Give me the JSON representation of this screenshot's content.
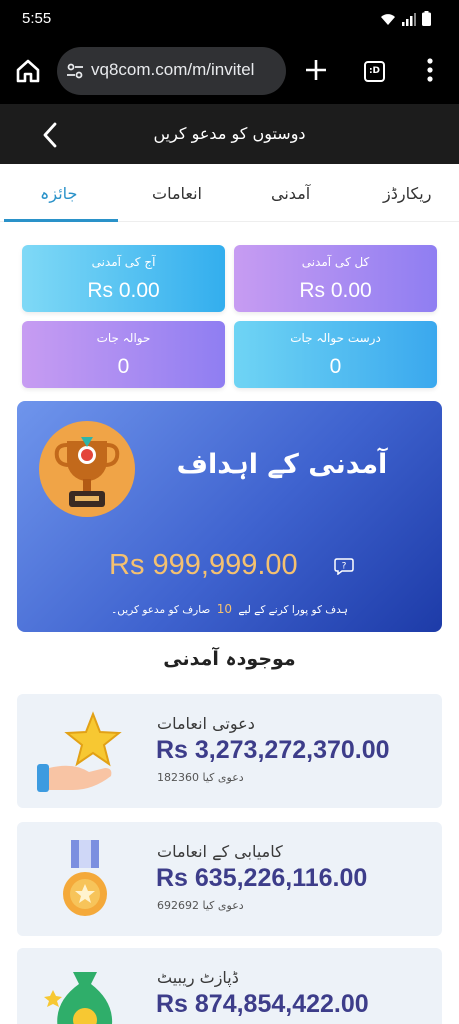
{
  "status": {
    "time": "5:55"
  },
  "browser": {
    "url": "vq8com.com/m/invitel",
    "tabs_label": ":D"
  },
  "header": {
    "title": "دوستوں کو مدعو کریں"
  },
  "tabs": [
    {
      "label": "ریکارڈز"
    },
    {
      "label": "آمدنی"
    },
    {
      "label": "انعامات"
    },
    {
      "label": "جائزہ",
      "active": true
    }
  ],
  "stats": {
    "today_earnings": {
      "label": "آج کی آمدنی",
      "value": "Rs 0.00"
    },
    "total_earnings": {
      "label": "کل کی آمدنی",
      "value": "Rs 0.00"
    },
    "referrals": {
      "label": "حوالہ جات",
      "value": "0"
    },
    "valid_referrals": {
      "label": "درست حوالہ جات",
      "value": "0"
    }
  },
  "goal": {
    "title": "آمدنی کے اہداف",
    "amount": "Rs 999,999.00",
    "note_before": "ہدف کو پورا کرنے کے لیے",
    "note_count": "10",
    "note_after": "صارف کو مدعو کریں۔"
  },
  "section_title": "موجودہ آمدنی",
  "earnings": [
    {
      "name": "دعوتی انعامات",
      "amount": "Rs 3,273,272,370.00",
      "count": "182360 دعوی کیا"
    },
    {
      "name": "کامیابی کے انعامات",
      "amount": "Rs 635,226,116.00",
      "count": "692692 دعوی کیا"
    },
    {
      "name": "ڈپازٹ ریبیٹ",
      "amount": "Rs 874,854,422.00"
    }
  ],
  "colors": {
    "accent": "#2a92c9",
    "goal_amount": "#f5c170",
    "earn_amount": "#3d3d8a"
  }
}
